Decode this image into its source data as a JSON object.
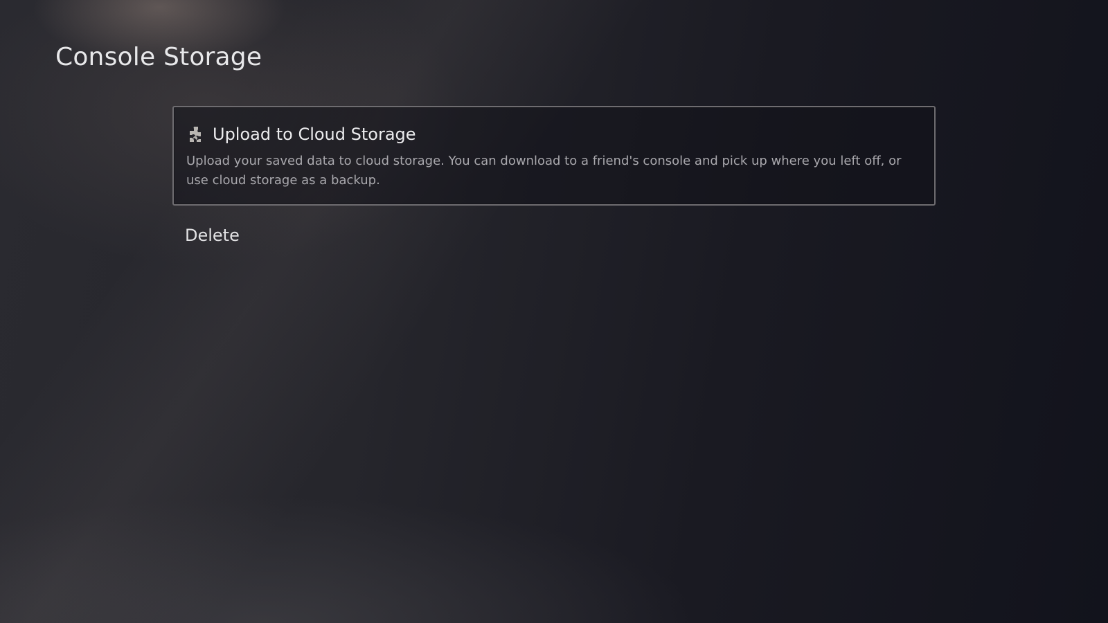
{
  "page": {
    "title": "Console Storage"
  },
  "options": [
    {
      "label": "Upload to Cloud Storage",
      "icon": "puzzle-piece-icon",
      "description": "Upload your saved data to cloud storage. You can download to a friend's console and pick up where you left off, or use cloud storage as a backup.",
      "focused": true
    },
    {
      "label": "Delete",
      "focused": false
    }
  ],
  "colors": {
    "focus_border": "#6e6c70",
    "icon": "#b9b6b2",
    "text_primary": "#ececee",
    "text_secondary": "#a9a8ad"
  }
}
